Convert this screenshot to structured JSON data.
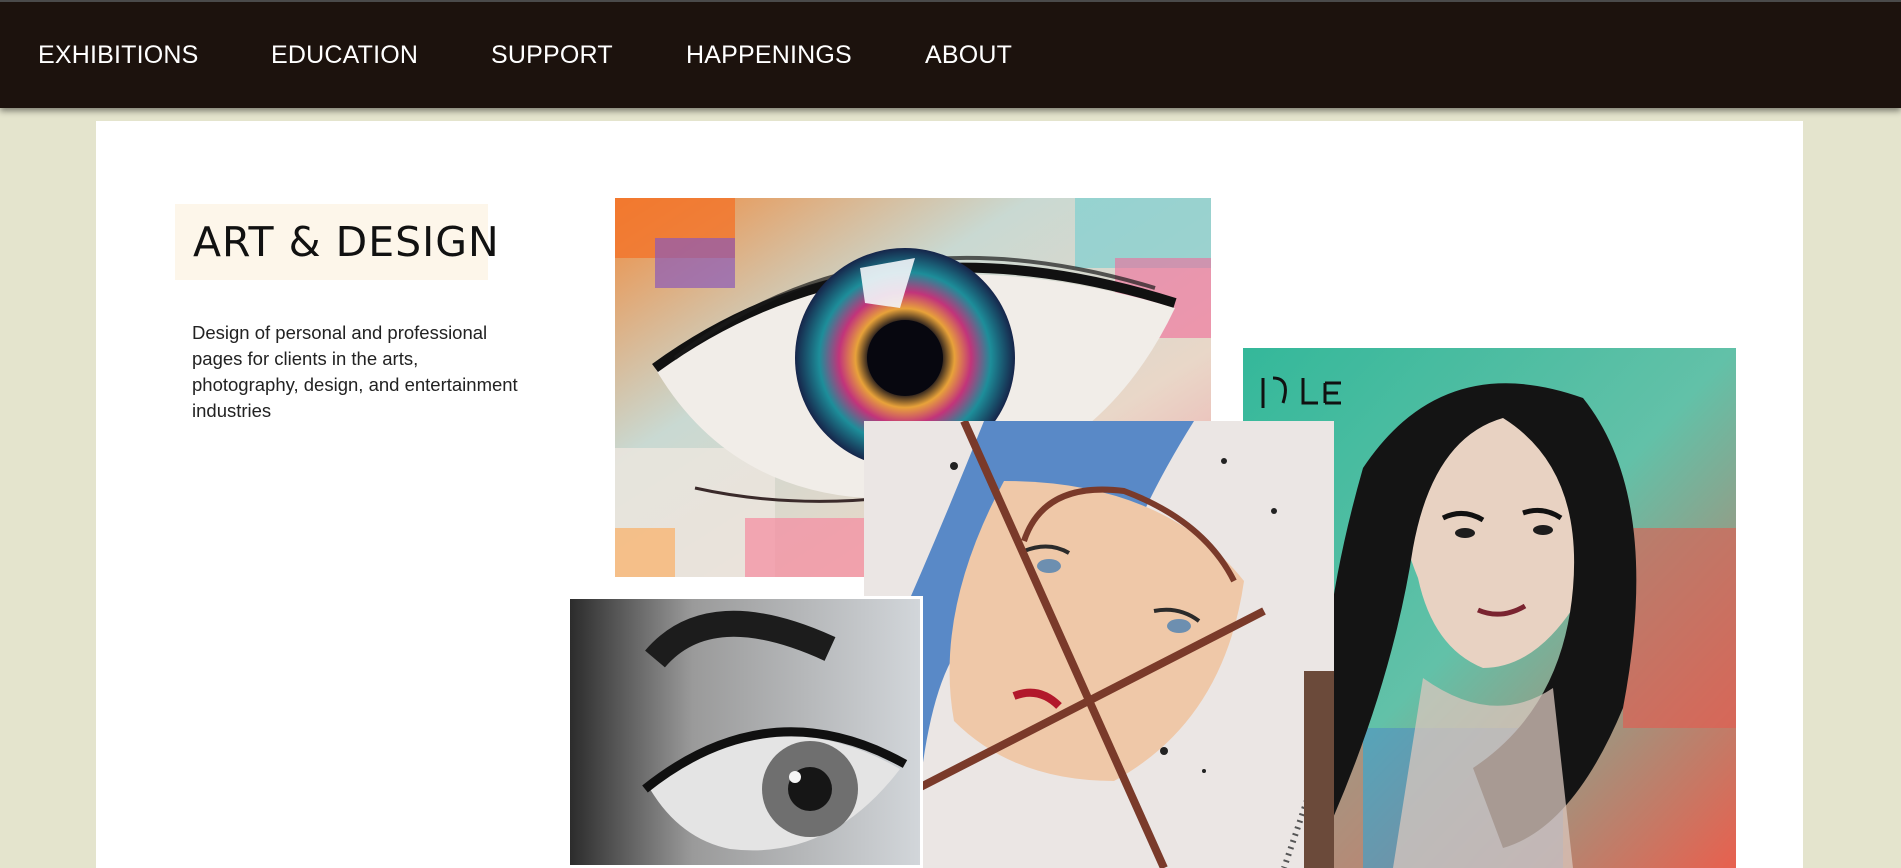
{
  "nav": {
    "items": [
      "EXHIBITIONS",
      "EDUCATION",
      "SUPPORT",
      "HAPPENINGS",
      "ABOUT"
    ]
  },
  "main": {
    "title": "ART & DESIGN",
    "description": "Design of personal and professional pages for clients in the arts, photography, design, and entertainment industries"
  },
  "gallery": [
    {
      "subject": "colorful-palette-knife-eye-painting"
    },
    {
      "subject": "ink-woman-portrait-painting",
      "signature": "Jolee"
    },
    {
      "subject": "broken-mirror-face-watercolor"
    },
    {
      "subject": "pencil-eye-drawing"
    }
  ],
  "colors": {
    "nav_bg": "#1c120d",
    "page_bg": "#e4e4cd",
    "title_bg": "#fdf6ea"
  }
}
